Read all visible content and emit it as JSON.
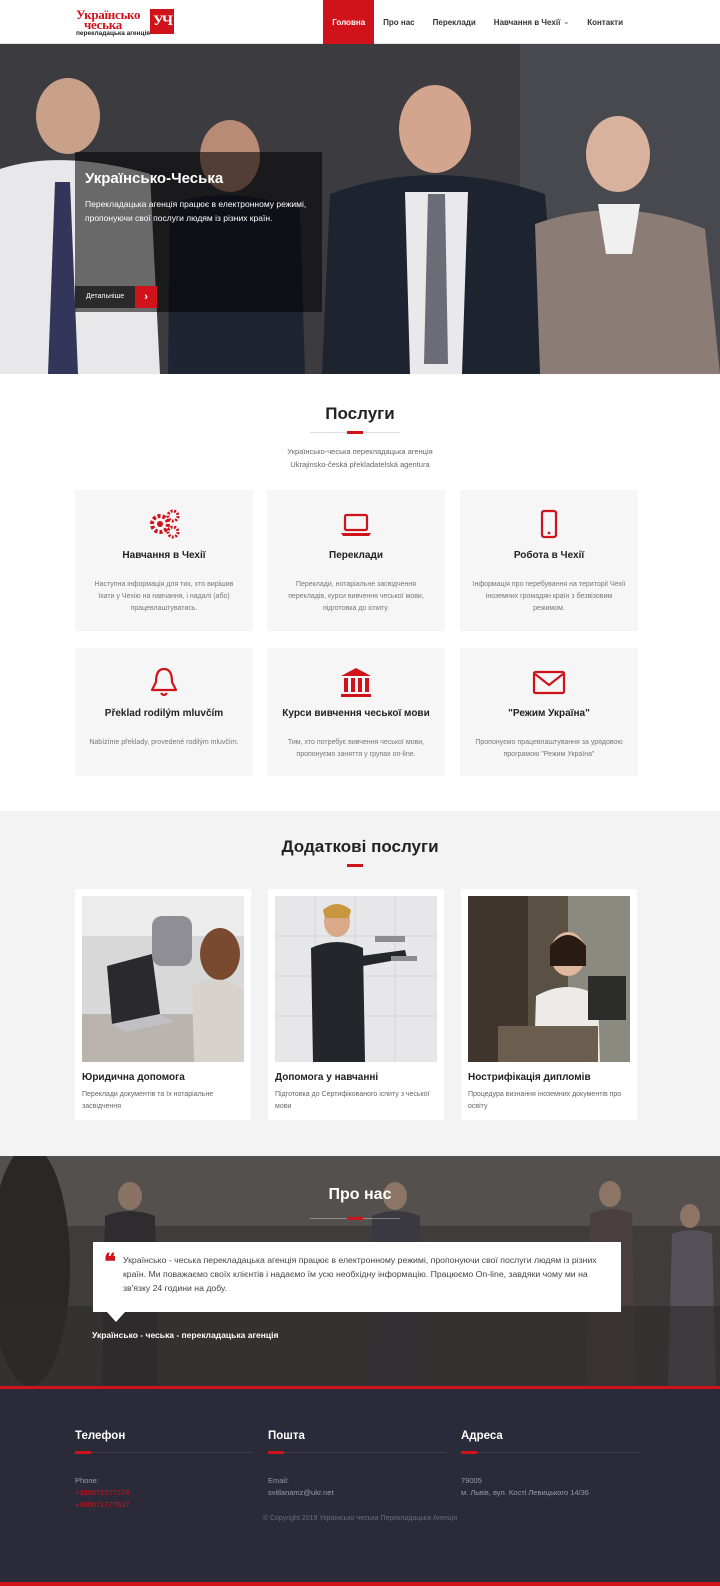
{
  "brand": {
    "logo_line1": "Українсько",
    "logo_line2": "чеська",
    "logo_sub": "перекладацька агенція",
    "logo_mark": "УЧ"
  },
  "nav": {
    "items": [
      "Головна",
      "Про нас",
      "Переклади",
      "Навчання в Чехії",
      "Контакти"
    ],
    "active": "Головна",
    "dropdown_item": "Навчання в Чехії"
  },
  "hero": {
    "title": "Українсько-Чеська",
    "text": "Перекладацька агенція працює в електронному режимі, пропонуючи свої послуги людям із різних країн.",
    "button_label": "Детальніше"
  },
  "services": {
    "title": "Послуги",
    "subtitle_line1": "Українсько-чеська перекладацька агенція",
    "subtitle_line2": "Ukrajinsko-česká překladatelská agentura",
    "cards": [
      {
        "icon": "gears-icon",
        "title": "Навчання в Чехії",
        "text": "Наступна інформація для тих, хто вирішив їхати у Чехію на навчання, і надалі (або) працевлаштуватись."
      },
      {
        "icon": "laptop-icon",
        "title": "Переклади",
        "text": "Переклади, нотаріальне засвідчення перекладів, курси вивчення чеської мови, підготовка до іспиту."
      },
      {
        "icon": "mobile-icon",
        "title": "Робота в Чехії",
        "text": "Інформація про перебування на території Чехії іноземних громадян країн з безвізовим режимом."
      },
      {
        "icon": "bell-icon",
        "title": "Překlad rodilým mluvčím",
        "text": "Nabízíme překlady, provedené rodilým mluvčím."
      },
      {
        "icon": "bank-icon",
        "title": "Курси вивчення чеської мови",
        "text": "Тим, хто потребує вивчення чеської мови, пропонуємо заняття у групах on-line."
      },
      {
        "icon": "envelope-icon",
        "title": "\"Режим Україна\"",
        "text": "Пропонуємо працевлаштування за урядовою програмою \"Режим Україна\""
      }
    ]
  },
  "extra": {
    "title": "Додаткові послуги",
    "cards": [
      {
        "title": "Юридична допомога",
        "text": "Переклади документів та їх нотаріальне засвідчення"
      },
      {
        "title": "Допомога у навчанні",
        "text": "Підготовка до Сертифікованого іспиту з чеської мови"
      },
      {
        "title": "Нострифікація дипломів",
        "text": "Процедура визнання іноземних документів про освіту"
      }
    ]
  },
  "about": {
    "title": "Про нас",
    "quote": "Українсько - чеська перекладацька агенція працює в електронному режимі, пропонуючи свої послуги людям із різних країн. Ми поважаємо своїх клієнтів і надаємо їм усю необхідну інформацію. Працюємо On-line, завдяки чому ми на зв'язку 24 години на добу.",
    "author": "Українсько - чеська -  перекладацька агенція"
  },
  "footer": {
    "phone": {
      "title": "Телефон",
      "label": "Phone:",
      "lines": [
        "+380671577174",
        "+380671777617"
      ]
    },
    "mail": {
      "title": "Пошта",
      "label": "Email:",
      "lines": [
        "svitlanamz@ukr.net"
      ]
    },
    "address": {
      "title": "Адреса",
      "label": "79005",
      "lines": [
        "м. Львів, вул. Костi Левицького 14/36"
      ]
    },
    "copyright": "© Copyright 2019 Українсько-чеська Перекладацька Агенція"
  },
  "colors": {
    "accent": "#d0121b",
    "footer_bg": "#2b2a38",
    "card_bg": "#f6f6f6"
  }
}
